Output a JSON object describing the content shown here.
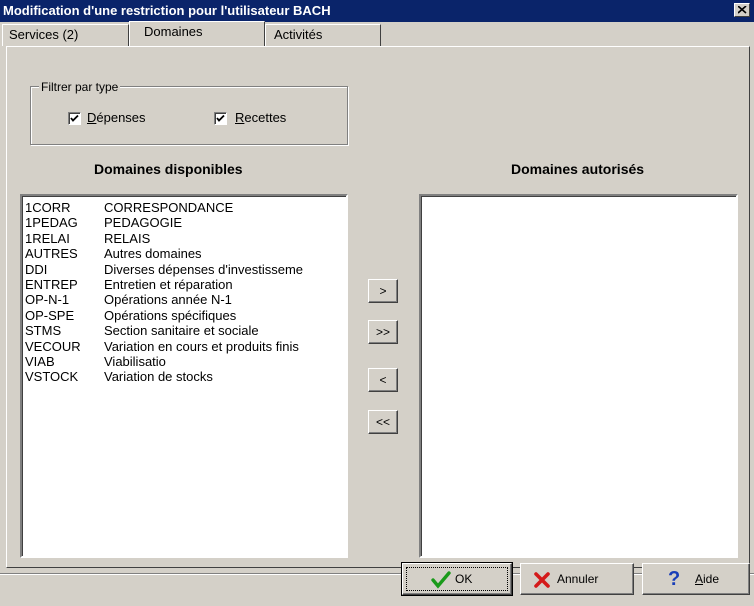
{
  "window": {
    "title": "Modification d'une restriction pour l'utilisateur BACH"
  },
  "tabs": [
    {
      "label": "Services (2)"
    },
    {
      "label": "Domaines"
    },
    {
      "label": "Activités"
    }
  ],
  "filter": {
    "group_label": "Filtrer par type",
    "depenses": {
      "first": "D",
      "rest": "épenses",
      "checked": true
    },
    "recettes": {
      "first": "R",
      "rest": "ecettes",
      "checked": true
    }
  },
  "available": {
    "title": "Domaines disponibles",
    "items": [
      {
        "code": "1CORR",
        "label": "CORRESPONDANCE"
      },
      {
        "code": "1PEDAG",
        "label": "PEDAGOGIE"
      },
      {
        "code": "1RELAI",
        "label": "RELAIS"
      },
      {
        "code": "AUTRES",
        "label": "Autres domaines"
      },
      {
        "code": "DDI",
        "label": "Diverses dépenses d'investisseme"
      },
      {
        "code": "ENTREP",
        "label": "Entretien et réparation"
      },
      {
        "code": "OP-N-1",
        "label": "Opérations année N-1"
      },
      {
        "code": "OP-SPE",
        "label": "Opérations spécifiques"
      },
      {
        "code": "STMS",
        "label": "Section sanitaire et sociale"
      },
      {
        "code": "VECOUR",
        "label": "Variation en cours et produits finis"
      },
      {
        "code": "VIAB",
        "label": "Viabilisatio"
      },
      {
        "code": "VSTOCK",
        "label": "Variation de stocks"
      }
    ]
  },
  "authorized": {
    "title": "Domaines autorisés",
    "items": []
  },
  "transfer": {
    "add_one": ">",
    "add_all": ">>",
    "remove_one": "<",
    "remove_all": "<<"
  },
  "footer": {
    "ok": "OK",
    "cancel": "Annuler",
    "help_first": "A",
    "help_rest": "ide"
  }
}
